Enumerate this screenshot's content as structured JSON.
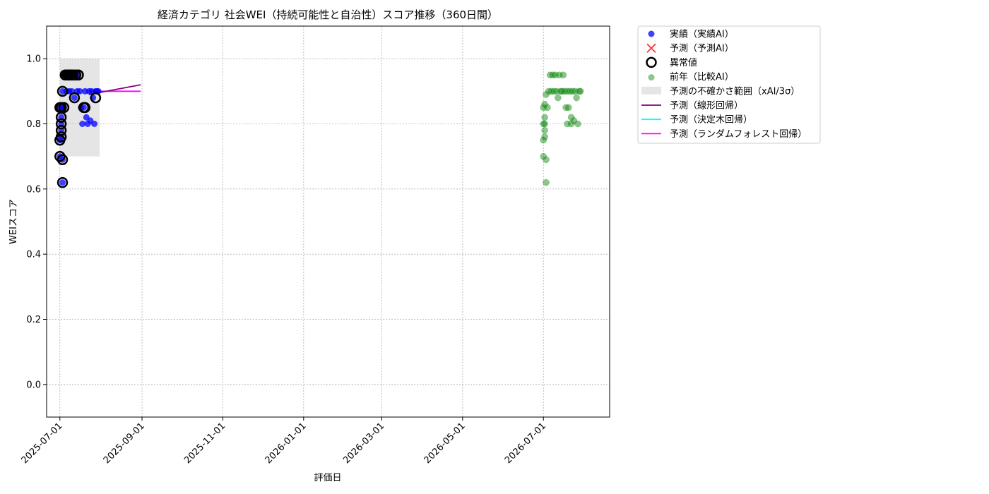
{
  "chart_data": {
    "type": "scatter",
    "title": "経済カテゴリ 社会WEI（持続可能性と自治性）スコア推移（360日間）",
    "xlabel": "評価日",
    "ylabel": "WEIスコア",
    "xlim": [
      "2025-06-21",
      "2026-08-20"
    ],
    "ylim": [
      -0.1,
      1.1
    ],
    "x_ticks": [
      "2025-07-01",
      "2025-09-01",
      "2025-11-01",
      "2026-01-01",
      "2026-03-01",
      "2026-05-01",
      "2026-07-01"
    ],
    "y_ticks": [
      "0.0",
      "0.2",
      "0.4",
      "0.6",
      "0.8",
      "1.0"
    ],
    "grid": true,
    "legend_position": "outside-right-top",
    "colors": {
      "actual": "#0000ff",
      "predicted": "#ff0000",
      "anomaly": "#000000",
      "previous_year": "#008000",
      "uncertainty_band": "#d3d3d3",
      "linear": "#800080",
      "tree": "#00ffff",
      "forest": "#ff00ff"
    },
    "legend": [
      {
        "key": "actual",
        "label": "実績（実績AI）",
        "marker": "dot"
      },
      {
        "key": "predicted",
        "label": "予測（予測AI）",
        "marker": "x"
      },
      {
        "key": "anomaly",
        "label": "異常値",
        "marker": "ring"
      },
      {
        "key": "previous_year",
        "label": "前年（比較AI）",
        "marker": "dot-light"
      },
      {
        "key": "uncertainty_band",
        "label": "予測の不確かさ範囲（xAI/3σ）",
        "marker": "patch"
      },
      {
        "key": "linear",
        "label": "予測（線形回帰）",
        "marker": "line"
      },
      {
        "key": "tree",
        "label": "予測（決定木回帰）",
        "marker": "line"
      },
      {
        "key": "forest",
        "label": "予測（ランダムフォレスト回帰）",
        "marker": "line"
      }
    ],
    "actual": [
      {
        "x": "2025-07-01",
        "y": 0.75
      },
      {
        "x": "2025-07-01",
        "y": 0.85
      },
      {
        "x": "2025-07-01",
        "y": 0.7
      },
      {
        "x": "2025-07-02",
        "y": 0.82
      },
      {
        "x": "2025-07-02",
        "y": 0.8
      },
      {
        "x": "2025-07-02",
        "y": 0.78
      },
      {
        "x": "2025-07-02",
        "y": 0.76
      },
      {
        "x": "2025-07-02",
        "y": 0.85
      },
      {
        "x": "2025-07-03",
        "y": 0.9
      },
      {
        "x": "2025-07-03",
        "y": 0.69
      },
      {
        "x": "2025-07-03",
        "y": 0.62
      },
      {
        "x": "2025-07-04",
        "y": 0.85
      },
      {
        "x": "2025-07-05",
        "y": 0.95
      },
      {
        "x": "2025-07-06",
        "y": 0.9
      },
      {
        "x": "2025-07-07",
        "y": 0.95
      },
      {
        "x": "2025-07-08",
        "y": 0.9
      },
      {
        "x": "2025-07-09",
        "y": 0.95
      },
      {
        "x": "2025-07-10",
        "y": 0.9
      },
      {
        "x": "2025-07-11",
        "y": 0.95
      },
      {
        "x": "2025-07-12",
        "y": 0.88
      },
      {
        "x": "2025-07-13",
        "y": 0.95
      },
      {
        "x": "2025-07-14",
        "y": 0.9
      },
      {
        "x": "2025-07-15",
        "y": 0.95
      },
      {
        "x": "2025-07-16",
        "y": 0.9
      },
      {
        "x": "2025-07-17",
        "y": 0.85
      },
      {
        "x": "2025-07-18",
        "y": 0.8
      },
      {
        "x": "2025-07-19",
        "y": 0.85
      },
      {
        "x": "2025-07-20",
        "y": 0.9
      },
      {
        "x": "2025-07-21",
        "y": 0.82
      },
      {
        "x": "2025-07-22",
        "y": 0.8
      },
      {
        "x": "2025-07-23",
        "y": 0.9
      },
      {
        "x": "2025-07-24",
        "y": 0.81
      },
      {
        "x": "2025-07-25",
        "y": 0.9
      },
      {
        "x": "2025-07-26",
        "y": 0.88
      },
      {
        "x": "2025-07-27",
        "y": 0.8
      },
      {
        "x": "2025-07-28",
        "y": 0.9
      },
      {
        "x": "2025-07-29",
        "y": 0.9
      },
      {
        "x": "2025-07-30",
        "y": 0.9
      }
    ],
    "anomalies": [
      {
        "x": "2025-07-01",
        "y": 0.75
      },
      {
        "x": "2025-07-01",
        "y": 0.85
      },
      {
        "x": "2025-07-01",
        "y": 0.7
      },
      {
        "x": "2025-07-02",
        "y": 0.82
      },
      {
        "x": "2025-07-02",
        "y": 0.8
      },
      {
        "x": "2025-07-02",
        "y": 0.78
      },
      {
        "x": "2025-07-02",
        "y": 0.76
      },
      {
        "x": "2025-07-02",
        "y": 0.85
      },
      {
        "x": "2025-07-03",
        "y": 0.9
      },
      {
        "x": "2025-07-03",
        "y": 0.69
      },
      {
        "x": "2025-07-03",
        "y": 0.62
      },
      {
        "x": "2025-07-04",
        "y": 0.85
      },
      {
        "x": "2025-07-05",
        "y": 0.95
      },
      {
        "x": "2025-07-06",
        "y": 0.95
      },
      {
        "x": "2025-07-07",
        "y": 0.95
      },
      {
        "x": "2025-07-08",
        "y": 0.95
      },
      {
        "x": "2025-07-09",
        "y": 0.95
      },
      {
        "x": "2025-07-10",
        "y": 0.95
      },
      {
        "x": "2025-07-11",
        "y": 0.95
      },
      {
        "x": "2025-07-12",
        "y": 0.88
      },
      {
        "x": "2025-07-13",
        "y": 0.95
      },
      {
        "x": "2025-07-15",
        "y": 0.95
      },
      {
        "x": "2025-07-19",
        "y": 0.85
      },
      {
        "x": "2025-07-20",
        "y": 0.85
      },
      {
        "x": "2025-07-28",
        "y": 0.88
      }
    ],
    "previous_year": [
      {
        "x": "2026-07-01",
        "y": 0.75
      },
      {
        "x": "2026-07-01",
        "y": 0.85
      },
      {
        "x": "2026-07-01",
        "y": 0.7
      },
      {
        "x": "2026-07-01",
        "y": 0.8
      },
      {
        "x": "2026-07-02",
        "y": 0.8
      },
      {
        "x": "2026-07-02",
        "y": 0.78
      },
      {
        "x": "2026-07-02",
        "y": 0.76
      },
      {
        "x": "2026-07-02",
        "y": 0.82
      },
      {
        "x": "2026-07-02",
        "y": 0.86
      },
      {
        "x": "2026-07-03",
        "y": 0.69
      },
      {
        "x": "2026-07-03",
        "y": 0.62
      },
      {
        "x": "2026-07-03",
        "y": 0.89
      },
      {
        "x": "2026-07-04",
        "y": 0.85
      },
      {
        "x": "2026-07-05",
        "y": 0.9
      },
      {
        "x": "2026-07-06",
        "y": 0.95
      },
      {
        "x": "2026-07-07",
        "y": 0.9
      },
      {
        "x": "2026-07-08",
        "y": 0.95
      },
      {
        "x": "2026-07-09",
        "y": 0.9
      },
      {
        "x": "2026-07-10",
        "y": 0.95
      },
      {
        "x": "2026-07-11",
        "y": 0.9
      },
      {
        "x": "2026-07-12",
        "y": 0.88
      },
      {
        "x": "2026-07-13",
        "y": 0.95
      },
      {
        "x": "2026-07-14",
        "y": 0.9
      },
      {
        "x": "2026-07-15",
        "y": 0.9
      },
      {
        "x": "2026-07-16",
        "y": 0.95
      },
      {
        "x": "2026-07-17",
        "y": 0.9
      },
      {
        "x": "2026-07-18",
        "y": 0.85
      },
      {
        "x": "2026-07-19",
        "y": 0.8
      },
      {
        "x": "2026-07-19",
        "y": 0.9
      },
      {
        "x": "2026-07-20",
        "y": 0.85
      },
      {
        "x": "2026-07-21",
        "y": 0.9
      },
      {
        "x": "2026-07-22",
        "y": 0.82
      },
      {
        "x": "2026-07-22",
        "y": 0.8
      },
      {
        "x": "2026-07-23",
        "y": 0.9
      },
      {
        "x": "2026-07-24",
        "y": 0.81
      },
      {
        "x": "2026-07-25",
        "y": 0.9
      },
      {
        "x": "2026-07-26",
        "y": 0.88
      },
      {
        "x": "2026-07-27",
        "y": 0.8
      },
      {
        "x": "2026-07-28",
        "y": 0.9
      },
      {
        "x": "2026-07-29",
        "y": 0.9
      }
    ],
    "uncertainty_band": {
      "x_start": "2025-07-01",
      "x_end": "2025-07-31",
      "y_low": 0.7,
      "y_high": 1.0
    },
    "linear": [
      {
        "x": "2025-07-23",
        "y": 0.89
      },
      {
        "x": "2025-08-31",
        "y": 0.92
      }
    ],
    "forest": [
      {
        "x": "2025-07-23",
        "y": 0.9
      },
      {
        "x": "2025-08-31",
        "y": 0.9
      }
    ]
  }
}
